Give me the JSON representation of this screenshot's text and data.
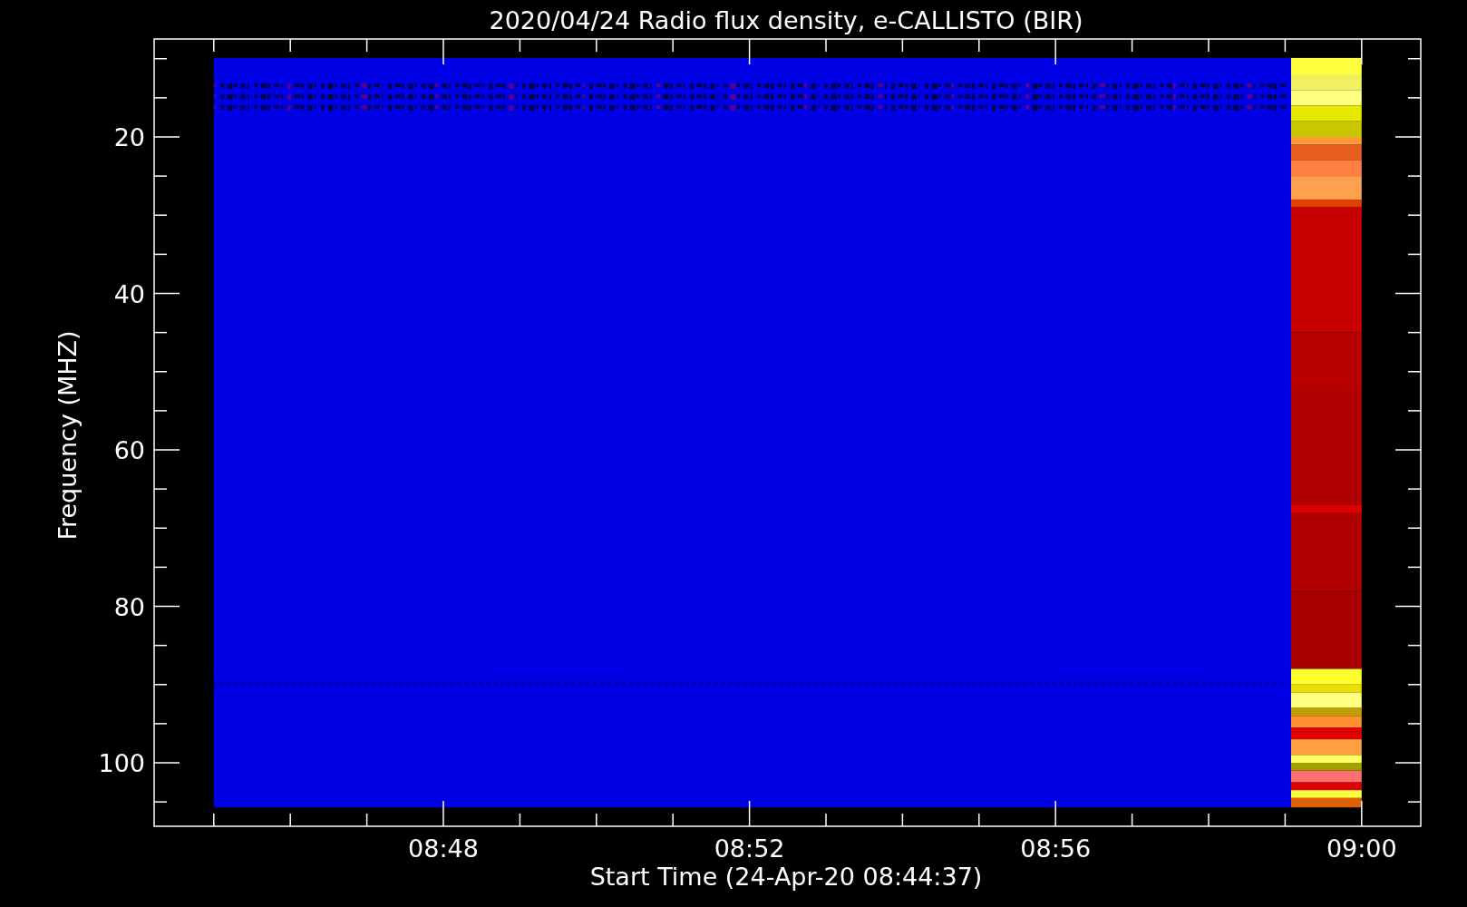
{
  "title": "2020/04/24  Radio flux density, e-CALLISTO (BIR)",
  "ylabel": "Frequency (MHZ)",
  "xlabel": "Start Time (24-Apr-20 08:44:37)",
  "y_tick_labels": [
    "20",
    "40",
    "60",
    "80",
    "100"
  ],
  "x_tick_labels": [
    "08:48",
    "08:52",
    "08:56",
    "09:00"
  ]
}
